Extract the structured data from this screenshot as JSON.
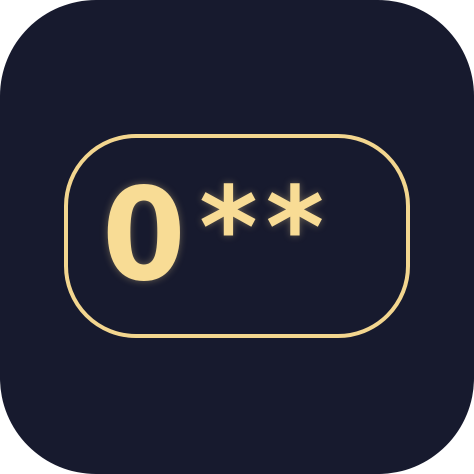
{
  "icon": {
    "background_color": "#171a2e",
    "accent_color": "#f3d68f",
    "visible_digit": "0",
    "mask_chars": [
      "*",
      "*"
    ]
  }
}
